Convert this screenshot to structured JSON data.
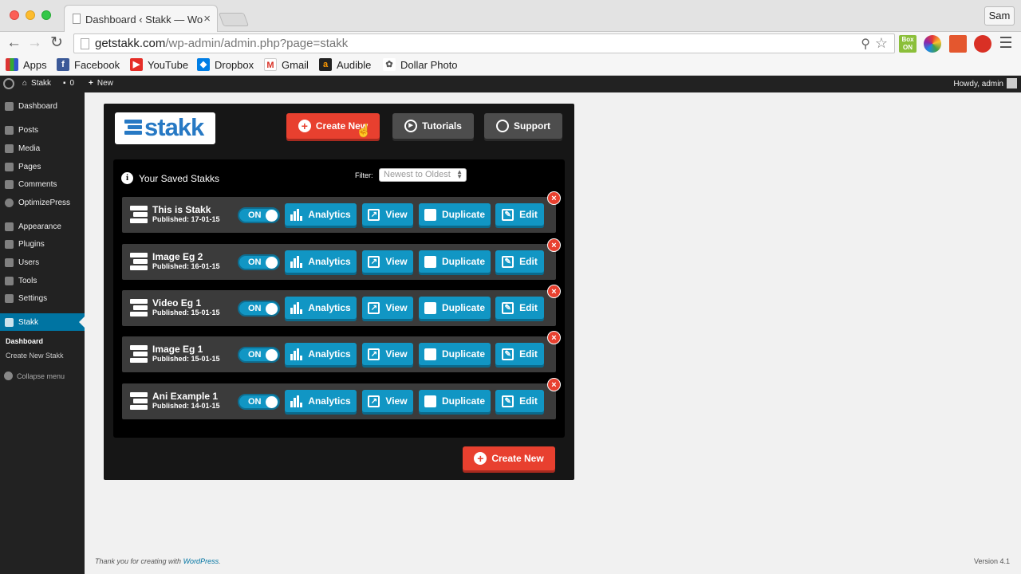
{
  "browser": {
    "tab_title": "Dashboard ‹ Stakk — WordPress",
    "tab_close": "×",
    "profile": "Sam",
    "url_domain": "getstakk.com",
    "url_path": "/wp-admin/admin.php?page=stakk",
    "ext_box_label": "Box ON",
    "bookmarks": [
      {
        "label": "Apps",
        "icon": "apps-icon"
      },
      {
        "label": "Facebook",
        "icon": "facebook-icon"
      },
      {
        "label": "YouTube",
        "icon": "youtube-icon"
      },
      {
        "label": "Dropbox",
        "icon": "dropbox-icon"
      },
      {
        "label": "Gmail",
        "icon": "gmail-icon"
      },
      {
        "label": "Audible",
        "icon": "audible-icon"
      },
      {
        "label": "Dollar Photo",
        "icon": "dollar-photo-icon"
      }
    ]
  },
  "adminbar": {
    "site": "Stakk",
    "comments": "0",
    "new": "New",
    "howdy": "Howdy, admin"
  },
  "sidebar": {
    "items": [
      {
        "label": "Dashboard"
      },
      {
        "label": "Posts"
      },
      {
        "label": "Media"
      },
      {
        "label": "Pages"
      },
      {
        "label": "Comments"
      },
      {
        "label": "OptimizePress"
      },
      {
        "label": "Appearance"
      },
      {
        "label": "Plugins"
      },
      {
        "label": "Users"
      },
      {
        "label": "Tools"
      },
      {
        "label": "Settings"
      },
      {
        "label": "Stakk"
      }
    ],
    "sub": {
      "current": "Dashboard",
      "create": "Create New Stakk"
    },
    "collapse": "Collapse menu"
  },
  "stakk": {
    "logo": "stakk",
    "create_new": "Create New",
    "tutorials": "Tutorials",
    "support": "Support",
    "saved_title": "Your Saved Stakks",
    "info_glyph": "i",
    "filter_label": "Filter:",
    "filter_value": "Newest to Oldest",
    "toggle_on": "ON",
    "actions": {
      "analytics": "Analytics",
      "view": "View",
      "duplicate": "Duplicate",
      "edit": "Edit"
    },
    "delete_glyph": "×",
    "rows": [
      {
        "title": "This is Stakk",
        "date": "Published: 17-01-15"
      },
      {
        "title": "Image Eg 2",
        "date": "Published: 16-01-15"
      },
      {
        "title": "Video Eg 1",
        "date": "Published: 15-01-15"
      },
      {
        "title": "Image Eg 1",
        "date": "Published: 15-01-15"
      },
      {
        "title": "Ani Example 1",
        "date": "Published: 14-01-15"
      }
    ]
  },
  "footer": {
    "thanks": "Thank you for creating with ",
    "wp": "WordPress",
    "period": ".",
    "version": "Version 4.1"
  }
}
